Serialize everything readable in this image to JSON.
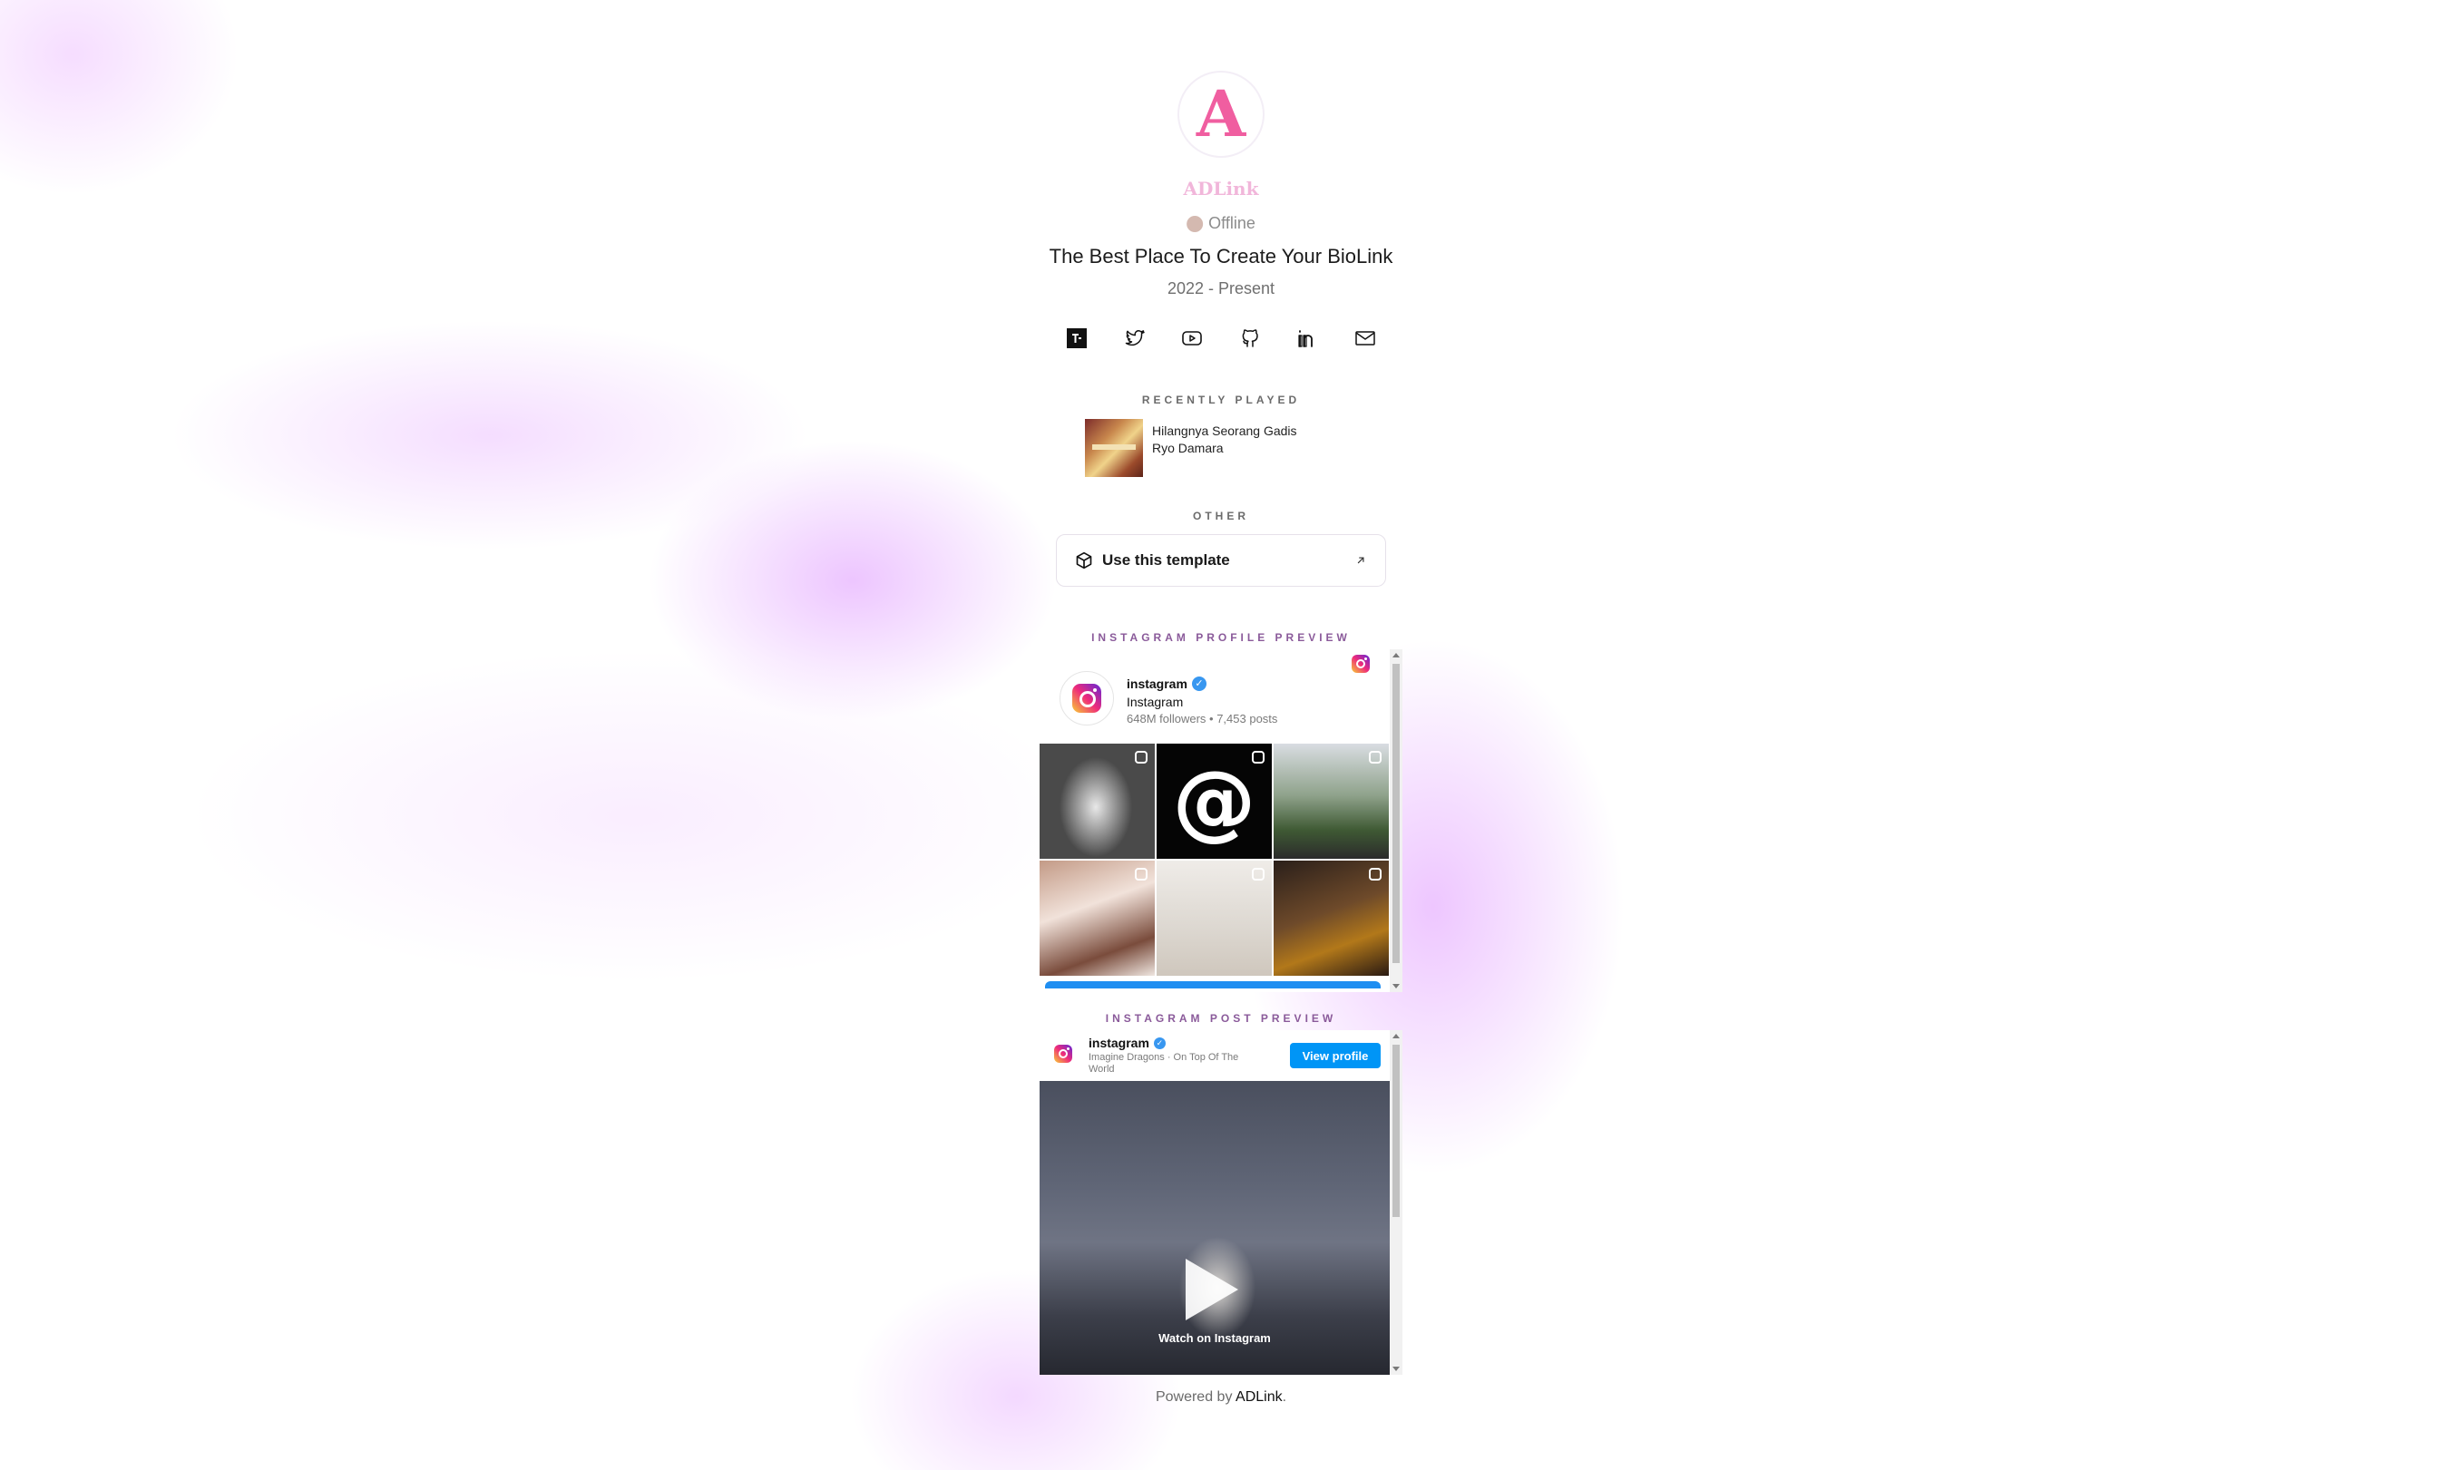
{
  "profile": {
    "avatar_letter": "A",
    "brand_name": "ADLink",
    "status": "Offline",
    "headline": "The Best Place To Create Your BioLink",
    "dates": "2022 - Present"
  },
  "socials": [
    {
      "icon": "tiktok-icon"
    },
    {
      "icon": "twitter-icon"
    },
    {
      "icon": "youtube-icon"
    },
    {
      "icon": "github-icon"
    },
    {
      "icon": "linkedin-icon"
    },
    {
      "icon": "mail-icon"
    }
  ],
  "recently_played": {
    "label": "RECENTLY PLAYED",
    "title": "Hilangnya Seorang Gadis",
    "artist": "Ryo Damara"
  },
  "other": {
    "label": "OTHER",
    "template_button": "Use this template"
  },
  "instagram_profile": {
    "label": "INSTAGRAM PROFILE PREVIEW",
    "username": "instagram",
    "display_name": "Instagram",
    "stats": "648M followers • 7,453 posts"
  },
  "instagram_post": {
    "label": "INSTAGRAM POST PREVIEW",
    "username": "instagram",
    "song": "Imagine Dragons · On Top Of The World",
    "view_profile": "View profile",
    "watch": "Watch on Instagram"
  },
  "footer": {
    "prefix": "Powered by ",
    "link": "ADLink",
    "suffix": "."
  },
  "colors": {
    "accent_pink": "#f05ea0",
    "instagram_blue": "#0095f6",
    "glow_purple": "#de96ff"
  }
}
